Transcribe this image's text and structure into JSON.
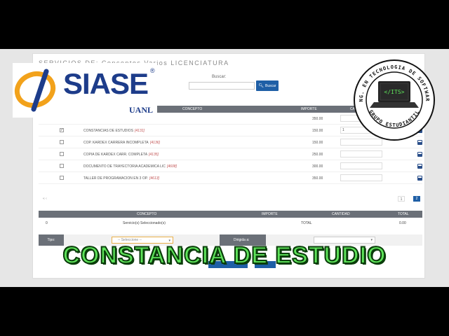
{
  "header": {
    "title": "SERVICIOS DE: Conceptos Varios LICENCIATURA"
  },
  "search": {
    "label": "Buscar:",
    "button_label": "Buscar",
    "value": ""
  },
  "services_table": {
    "columns": [
      "CONCEPTO",
      "IMPORTE",
      "CANTIDAD"
    ],
    "rows": [
      {
        "concepto": "",
        "code": "",
        "importe": "350.00",
        "checked": false,
        "cantidad": ""
      },
      {
        "concepto": "CONSTANCIAS DE ESTUDIOS",
        "code": "[4131]",
        "importe": "150.00",
        "checked": true,
        "cantidad": "1"
      },
      {
        "concepto": "COP. KARDEX CARRERA INCOMPLETA",
        "code": "[4136]",
        "importe": "150.00",
        "checked": false,
        "cantidad": ""
      },
      {
        "concepto": "COPIA DE KARDEX CARR. COMPLETA",
        "code": "[4135]",
        "importe": "250.00",
        "checked": false,
        "cantidad": ""
      },
      {
        "concepto": "DOCUMENTO DE TRAYECTORIA ACADEMICA LIC",
        "code": "[4608]",
        "importe": "300.00",
        "checked": false,
        "cantidad": ""
      },
      {
        "concepto": "TALLER DE PROGRAMACION EN 3 OP.",
        "code": "[4613]",
        "importe": "350.00",
        "checked": false,
        "cantidad": ""
      }
    ]
  },
  "pagination": {
    "pages": [
      "1",
      "2"
    ],
    "current": "2"
  },
  "summary_table": {
    "columns": [
      "CONCEPTO",
      "IMPORTE",
      "CANTIDAD",
      "TOTAL"
    ],
    "row": {
      "count": "0",
      "concepto": "Servicio(s) Seleccionado(s)",
      "importe": "TOTAL",
      "total": "0.00"
    }
  },
  "form": {
    "tipo_label": "Tipo:",
    "tipo_value": "-- Seleccione --",
    "dirigida_label": "Dirigida a:",
    "dirigida_value": ""
  },
  "logo": {
    "name": "SIASE",
    "registered": "®",
    "sub": "UANL"
  },
  "badge": {
    "top_text": "ING. EN TECNOLOGIA DE SOFTWARE",
    "bottom_text": "GRUPO ESTUDIANTIL",
    "screen_text": "</ITS>"
  },
  "overlay": {
    "text": "CONSTANCIA DE ESTUDIO"
  },
  "colors": {
    "accent": "#1f5fa6",
    "header_gray": "#6b7078",
    "overlay_green": "#5ee35a"
  }
}
